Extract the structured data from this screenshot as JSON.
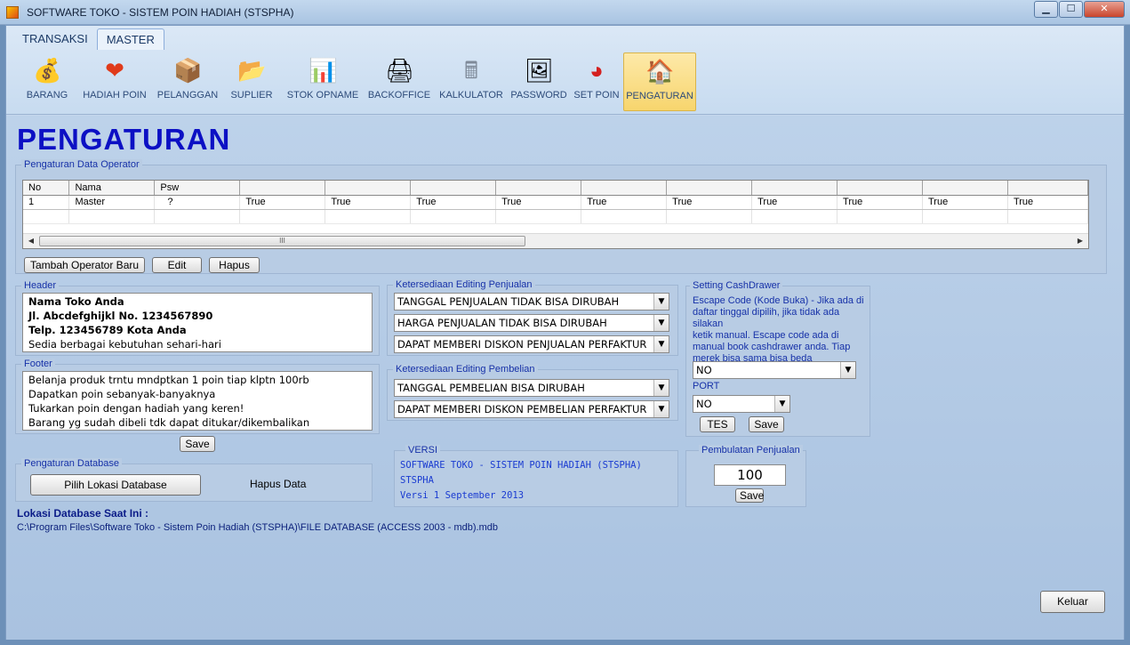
{
  "window": {
    "title": "SOFTWARE TOKO - SISTEM POIN HADIAH (STSPHA)",
    "minimize": "▁",
    "maximize": "☐",
    "close": "✕"
  },
  "tabs": [
    {
      "label": "TRANSAKSI"
    },
    {
      "label": "MASTER"
    }
  ],
  "tools": [
    {
      "label": "BARANG",
      "icon": "coins-icon",
      "glyph": "💰"
    },
    {
      "label": "HADIAH POIN",
      "icon": "heart-icon",
      "glyph": "❤"
    },
    {
      "label": "PELANGGAN",
      "icon": "box-icon",
      "glyph": "📦"
    },
    {
      "label": "SUPLIER",
      "icon": "folder-icon",
      "glyph": "📂"
    },
    {
      "label": "STOK OPNAME",
      "icon": "chart-check-icon",
      "glyph": "📊"
    },
    {
      "label": "BACKOFFICE",
      "icon": "printer-user-icon",
      "glyph": "🖨"
    },
    {
      "label": "KALKULATOR",
      "icon": "calculator-icon",
      "glyph": "🖩"
    },
    {
      "label": "PASSWORD",
      "icon": "landscape-lock-icon",
      "glyph": "🖼"
    },
    {
      "label": "SET POIN",
      "icon": "pie-chart-icon",
      "glyph": "◕"
    },
    {
      "label": "PENGATURAN",
      "icon": "house-icon",
      "glyph": "🏠"
    }
  ],
  "page": {
    "title": "PENGATURAN"
  },
  "operator": {
    "title": "Pengaturan Data Operator",
    "columns": [
      "No",
      "Nama",
      "Psw",
      "",
      "",
      "",
      "",
      "",
      "",
      "",
      "",
      "",
      ""
    ],
    "rows": [
      [
        "1",
        "Master",
        "?",
        "True",
        "True",
        "True",
        "True",
        "True",
        "True",
        "True",
        "True",
        "True",
        "True"
      ]
    ],
    "scroll_grip": "III",
    "add_button": "Tambah Operator Baru",
    "edit_button": "Edit",
    "delete_button": "Hapus"
  },
  "header": {
    "title": "Header",
    "lines": [
      "Nama Toko Anda",
      "Jl. Abcdefghijkl No. 1234567890",
      "Telp. 123456789 Kota Anda",
      "Sedia berbagai kebutuhan sehari-hari"
    ]
  },
  "footer": {
    "title": "Footer",
    "lines": [
      "Belanja produk trntu mndptkan 1 poin tiap klptn 100rb",
      "Dapatkan poin sebanyak-banyaknya",
      "Tukarkan poin dengan hadiah yang keren!",
      "Barang yg sudah dibeli tdk dapat ditukar/dikembalikan"
    ],
    "save_button": "Save"
  },
  "database": {
    "title": "Pengaturan Database",
    "pick_button": "Pilih Lokasi Database",
    "delete_label": "Hapus Data",
    "location_label": "Lokasi Database Saat Ini :",
    "location_path": "C:\\Program Files\\Software Toko - Sistem Poin Hadiah (STSPHA)\\FILE DATABASE (ACCESS 2003 - mdb).mdb"
  },
  "sales_edit": {
    "title": "Ketersediaan Editing Penjualan",
    "options": [
      "TANGGAL PENJUALAN TIDAK BISA DIRUBAH",
      "HARGA PENJUALAN TIDAK BISA DIRUBAH",
      "DAPAT MEMBERI DISKON PENJUALAN PERFAKTUR"
    ]
  },
  "purchase_edit": {
    "title": "Ketersediaan Editing Pembelian",
    "options": [
      "TANGGAL PEMBELIAN BISA DIRUBAH",
      "DAPAT MEMBERI DISKON PEMBELIAN PERFAKTUR"
    ]
  },
  "version": {
    "title": "VERSI",
    "lines": [
      "SOFTWARE TOKO - SISTEM POIN HADIAH (STSPHA)",
      "STSPHA",
      "Versi 1 September 2013"
    ]
  },
  "cashdrawer": {
    "title": "Setting CashDrawer",
    "description": [
      "Escape Code (Kode Buka) - Jika ada di",
      "daftar tinggal dipilih, jika tidak ada silakan",
      "ketik manual. Escape code ada di",
      "manual book cashdrawer anda. Tiap",
      "merek bisa sama bisa beda"
    ],
    "escape_value": "NO",
    "port_label": "PORT",
    "port_value": "NO",
    "test_button": "TES",
    "save_button": "Save"
  },
  "rounding": {
    "title": "Pembulatan Penjualan",
    "value": "100",
    "save_button": "Save"
  },
  "exit_button": "Keluar"
}
